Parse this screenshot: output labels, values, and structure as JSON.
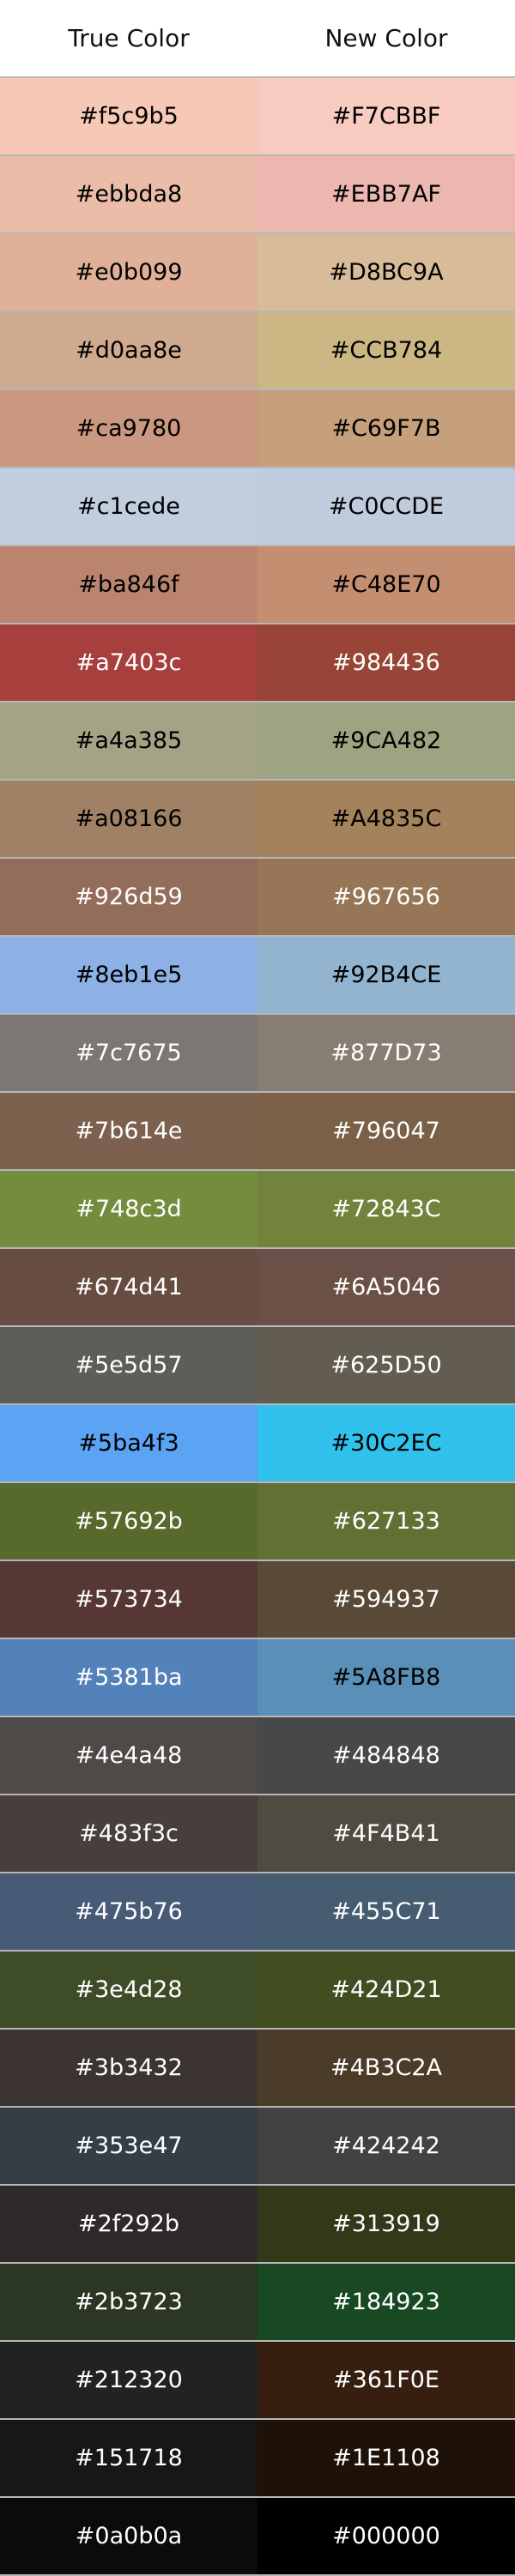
{
  "header": {
    "true_label": "True Color",
    "new_label": "New Color"
  },
  "rows": [
    {
      "true_text": "#f5c9b5",
      "true_bg": "#f5c9b5",
      "true_fg": "#000000",
      "new_text": "#F7CBBF",
      "new_bg": "#F7CBBF",
      "new_fg": "#000000"
    },
    {
      "true_text": "#ebbda8",
      "true_bg": "#ebbda8",
      "true_fg": "#000000",
      "new_text": "#EBB7AF",
      "new_bg": "#EBB7AF",
      "new_fg": "#000000"
    },
    {
      "true_text": "#e0b099",
      "true_bg": "#e0b099",
      "true_fg": "#000000",
      "new_text": "#D8BC9A",
      "new_bg": "#D8BC9A",
      "new_fg": "#000000"
    },
    {
      "true_text": "#d0aa8e",
      "true_bg": "#d0aa8e",
      "true_fg": "#000000",
      "new_text": "#CCB784",
      "new_bg": "#CCB784",
      "new_fg": "#000000"
    },
    {
      "true_text": "#ca9780",
      "true_bg": "#ca9780",
      "true_fg": "#000000",
      "new_text": "#C69F7B",
      "new_bg": "#C69F7B",
      "new_fg": "#000000"
    },
    {
      "true_text": "#c1cede",
      "true_bg": "#c1cede",
      "true_fg": "#000000",
      "new_text": "#C0CCDE",
      "new_bg": "#C0CCDE",
      "new_fg": "#000000"
    },
    {
      "true_text": "#ba846f",
      "true_bg": "#ba846f",
      "true_fg": "#000000",
      "new_text": "#C48E70",
      "new_bg": "#C48E70",
      "new_fg": "#000000"
    },
    {
      "true_text": "#a7403c",
      "true_bg": "#a7403c",
      "true_fg": "#ffffff",
      "new_text": "#984436",
      "new_bg": "#984436",
      "new_fg": "#ffffff"
    },
    {
      "true_text": "#a4a385",
      "true_bg": "#a4a385",
      "true_fg": "#000000",
      "new_text": "#9CA482",
      "new_bg": "#9CA482",
      "new_fg": "#000000"
    },
    {
      "true_text": "#a08166",
      "true_bg": "#a08166",
      "true_fg": "#000000",
      "new_text": "#A4835C",
      "new_bg": "#A4835C",
      "new_fg": "#000000"
    },
    {
      "true_text": "#926d59",
      "true_bg": "#926d59",
      "true_fg": "#ffffff",
      "new_text": "#967656",
      "new_bg": "#967656",
      "new_fg": "#ffffff"
    },
    {
      "true_text": "#8eb1e5",
      "true_bg": "#8eb1e5",
      "true_fg": "#000000",
      "new_text": "#92B4CE",
      "new_bg": "#92B4CE",
      "new_fg": "#000000"
    },
    {
      "true_text": "#7c7675",
      "true_bg": "#7c7675",
      "true_fg": "#ffffff",
      "new_text": "#877D73",
      "new_bg": "#877D73",
      "new_fg": "#ffffff"
    },
    {
      "true_text": "#7b614e",
      "true_bg": "#7b614e",
      "true_fg": "#ffffff",
      "new_text": "#796047",
      "new_bg": "#796047",
      "new_fg": "#ffffff"
    },
    {
      "true_text": "#748c3d",
      "true_bg": "#748c3d",
      "true_fg": "#ffffff",
      "new_text": "#72843C",
      "new_bg": "#72843C",
      "new_fg": "#ffffff"
    },
    {
      "true_text": "#674d41",
      "true_bg": "#674d41",
      "true_fg": "#ffffff",
      "new_text": "#6A5046",
      "new_bg": "#6A5046",
      "new_fg": "#ffffff"
    },
    {
      "true_text": "#5e5d57",
      "true_bg": "#5e5d57",
      "true_fg": "#ffffff",
      "new_text": "#625D50",
      "new_bg": "#625D50",
      "new_fg": "#ffffff"
    },
    {
      "true_text": "#5ba4f3",
      "true_bg": "#5ba4f3",
      "true_fg": "#000000",
      "new_text": "#30C2EC",
      "new_bg": "#30C2EC",
      "new_fg": "#000000"
    },
    {
      "true_text": "#57692b",
      "true_bg": "#57692b",
      "true_fg": "#ffffff",
      "new_text": "#627133",
      "new_bg": "#627133",
      "new_fg": "#ffffff"
    },
    {
      "true_text": "#573734",
      "true_bg": "#573734",
      "true_fg": "#ffffff",
      "new_text": "#594937",
      "new_bg": "#594937",
      "new_fg": "#ffffff"
    },
    {
      "true_text": "#5381ba",
      "true_bg": "#5381ba",
      "true_fg": "#ffffff",
      "new_text": "#5A8FB8",
      "new_bg": "#5A8FB8",
      "new_fg": "#000000"
    },
    {
      "true_text": "#4e4a48",
      "true_bg": "#4e4a48",
      "true_fg": "#ffffff",
      "new_text": "#484848",
      "new_bg": "#484848",
      "new_fg": "#ffffff"
    },
    {
      "true_text": "#483f3c",
      "true_bg": "#483f3c",
      "true_fg": "#ffffff",
      "new_text": "#4F4B41",
      "new_bg": "#4F4B41",
      "new_fg": "#ffffff"
    },
    {
      "true_text": "#475b76",
      "true_bg": "#475b76",
      "true_fg": "#ffffff",
      "new_text": "#455C71",
      "new_bg": "#455C71",
      "new_fg": "#ffffff"
    },
    {
      "true_text": "#3e4d28",
      "true_bg": "#3e4d28",
      "true_fg": "#ffffff",
      "new_text": "#424D21",
      "new_bg": "#424D21",
      "new_fg": "#ffffff"
    },
    {
      "true_text": "#3b3432",
      "true_bg": "#3b3432",
      "true_fg": "#ffffff",
      "new_text": "#4B3C2A",
      "new_bg": "#4B3C2A",
      "new_fg": "#ffffff"
    },
    {
      "true_text": "#353e47",
      "true_bg": "#353e47",
      "true_fg": "#ffffff",
      "new_text": "#424242",
      "new_bg": "#424242",
      "new_fg": "#ffffff"
    },
    {
      "true_text": "#2f292b",
      "true_bg": "#2f292b",
      "true_fg": "#ffffff",
      "new_text": "#313919",
      "new_bg": "#313919",
      "new_fg": "#ffffff"
    },
    {
      "true_text": "#2b3723",
      "true_bg": "#2b3723",
      "true_fg": "#ffffff",
      "new_text": "#184923",
      "new_bg": "#184923",
      "new_fg": "#ffffff"
    },
    {
      "true_text": "#212320",
      "true_bg": "#212320",
      "true_fg": "#ffffff",
      "new_text": "#361F0E",
      "new_bg": "#361F0E",
      "new_fg": "#ffffff"
    },
    {
      "true_text": "#151718",
      "true_bg": "#151718",
      "true_fg": "#ffffff",
      "new_text": "#1E1108",
      "new_bg": "#1E1108",
      "new_fg": "#ffffff"
    },
    {
      "true_text": "#0a0b0a",
      "true_bg": "#0a0b0a",
      "true_fg": "#ffffff",
      "new_text": "#000000",
      "new_bg": "#000000",
      "new_fg": "#ffffff"
    }
  ]
}
